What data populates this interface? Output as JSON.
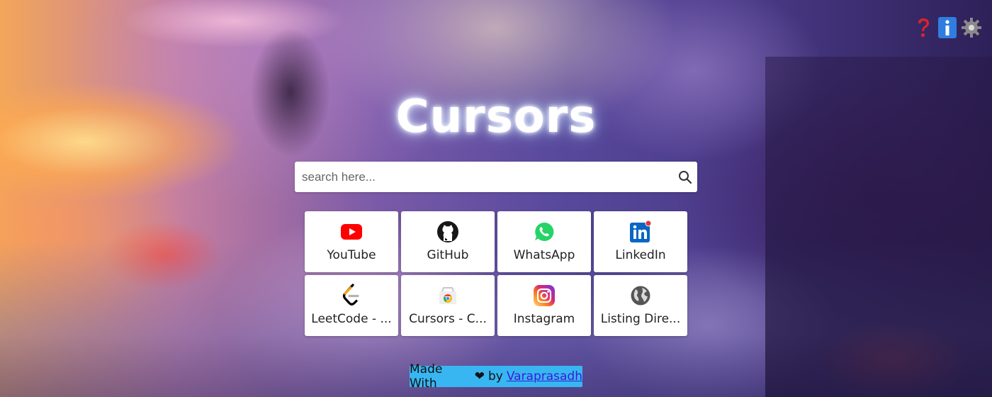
{
  "app": {
    "title": "Cursors"
  },
  "search": {
    "placeholder": "search here...",
    "value": "",
    "icon": "search-icon"
  },
  "shortcuts": [
    {
      "label": "YouTube",
      "icon": "youtube-icon",
      "color": "#ff0000"
    },
    {
      "label": "GitHub",
      "icon": "github-icon",
      "color": "#181717"
    },
    {
      "label": "WhatsApp",
      "icon": "whatsapp-icon",
      "color": "#25d366"
    },
    {
      "label": "LinkedIn",
      "icon": "linkedin-icon",
      "color": "#0a66c2"
    },
    {
      "label": "LeetCode - ...",
      "icon": "leetcode-icon",
      "color": "#ffa116"
    },
    {
      "label": "Cursors - C...",
      "icon": "chrome-web-store-icon",
      "color": "#4285f4"
    },
    {
      "label": "Instagram",
      "icon": "instagram-icon",
      "color": "#e1306c"
    },
    {
      "label": "Listing Dire...",
      "icon": "globe-icon",
      "color": "#555555"
    }
  ],
  "top_icons": [
    {
      "name": "help-icon",
      "color": "#d9232e"
    },
    {
      "name": "info-icon",
      "color": "#2f7de1"
    },
    {
      "name": "gear-icon",
      "color": "#8a8a8a"
    }
  ],
  "footer": {
    "prefix": "Made With",
    "heart": "❤",
    "by": "by",
    "author": "Varaprasadh",
    "bg": "#38b6f2"
  }
}
